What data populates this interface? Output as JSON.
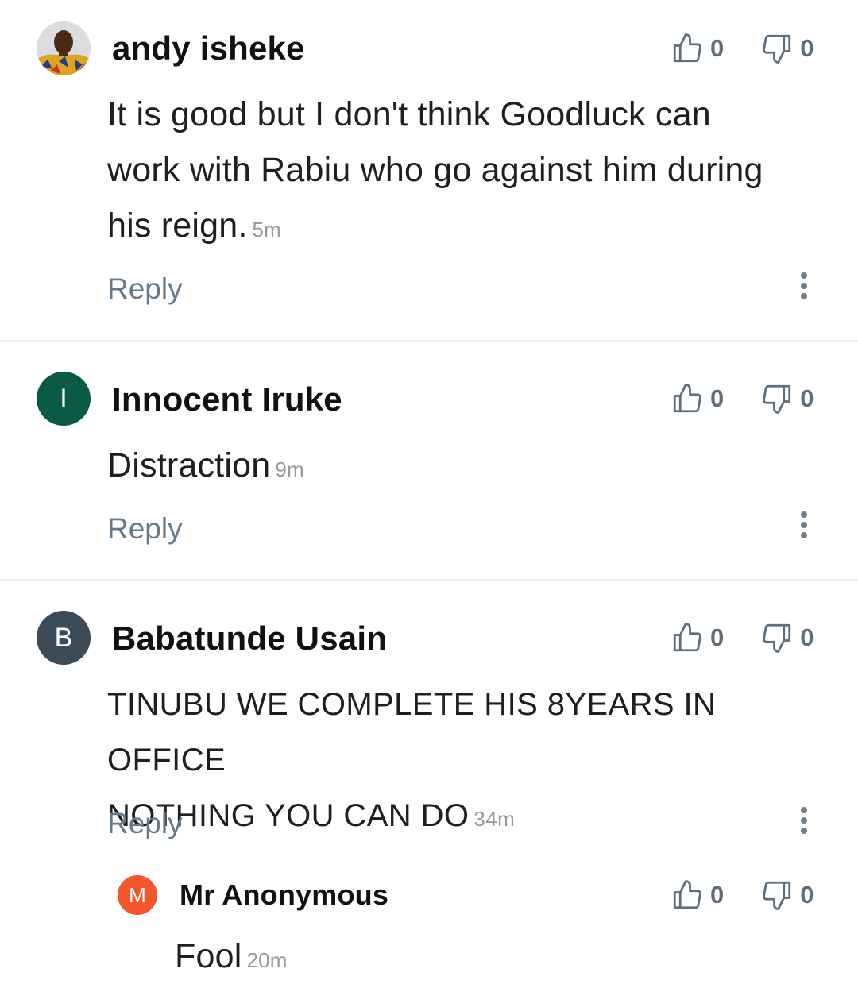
{
  "comments": [
    {
      "author": "andy isheke",
      "avatar_type": "photo",
      "body_lines": [
        "It is good but I don't think Goodluck can",
        "work with Rabiu who go against him during",
        "his reign."
      ],
      "time": "5m",
      "likes": "0",
      "dislikes": "0",
      "reply_label": "Reply"
    },
    {
      "author": "Innocent Iruke",
      "avatar_initial": "I",
      "avatar_color": "#0b5a45",
      "body_lines": [
        "Distraction"
      ],
      "time": "9m",
      "likes": "0",
      "dislikes": "0",
      "reply_label": "Reply"
    },
    {
      "author": "Babatunde Usain",
      "avatar_initial": "B",
      "avatar_color": "#3c4b58",
      "body_lines": [
        "TINUBU WE COMPLETE HIS 8YEARS IN OFFICE",
        "NOTHING YOU CAN DO"
      ],
      "time": "34m",
      "likes": "0",
      "dislikes": "0",
      "reply_label": "Reply",
      "replies": [
        {
          "author": "Mr Anonymous",
          "avatar_initial": "M",
          "avatar_color": "#f2562a",
          "body_lines": [
            "Fool"
          ],
          "time": "20m",
          "likes": "0",
          "dislikes": "0"
        }
      ]
    }
  ],
  "icons": {
    "like": "thumbs-up-icon",
    "dislike": "thumbs-down-icon",
    "more": "more-vertical-icon"
  }
}
